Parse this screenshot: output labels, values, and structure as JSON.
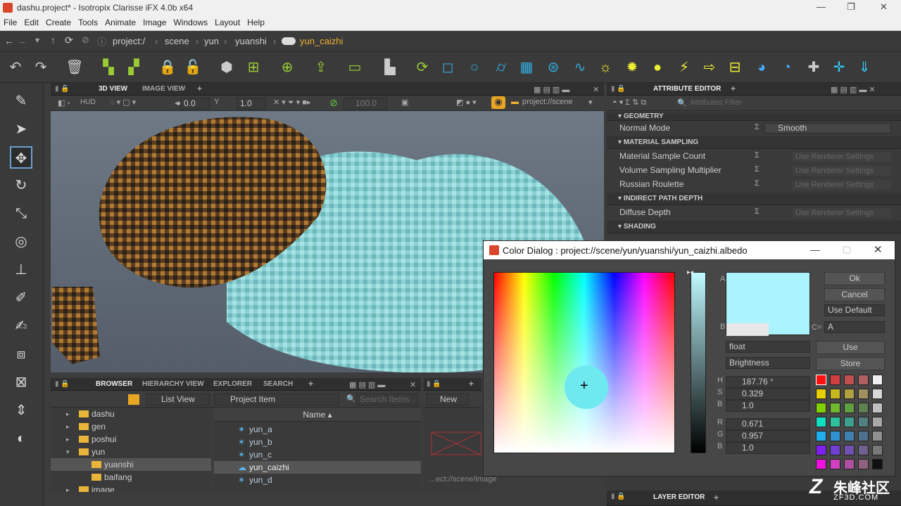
{
  "window": {
    "title": "dashu.project* - Isotropix Clarisse iFX 4.0b x64"
  },
  "menu": [
    "File",
    "Edit",
    "Create",
    "Tools",
    "Animate",
    "Image",
    "Windows",
    "Layout",
    "Help"
  ],
  "breadcrumb": [
    "project:/",
    "scene",
    "yun",
    "yuanshi",
    "yun_caizhi"
  ],
  "viewport": {
    "tabs": [
      "3D VIEW",
      "IMAGE VIEW"
    ],
    "hud": "HUD",
    "field1": "0.0",
    "field2": "1.0",
    "zoom": "100.0 %",
    "path": "project://scene"
  },
  "browser": {
    "tabs": [
      "BROWSER",
      "HIERARCHY VIEW",
      "EXPLORER",
      "SEARCH"
    ],
    "view_mode": "List View",
    "filter": "Project Item",
    "search_placeholder": "Search Items",
    "column_name": "Name",
    "tree": [
      {
        "label": "dashu",
        "indent": 0
      },
      {
        "label": "gen",
        "indent": 0
      },
      {
        "label": "poshui",
        "indent": 0
      },
      {
        "label": "yun",
        "indent": 0
      },
      {
        "label": "yuanshi",
        "indent": 1
      },
      {
        "label": "baifang",
        "indent": 1
      },
      {
        "label": "image",
        "indent": 0
      }
    ],
    "items": [
      "yun_a",
      "yun_b",
      "yun_c",
      "yun_caizhi",
      "yun_d"
    ],
    "new_label": "New",
    "image_path": "...ect://scene/image"
  },
  "attributes": {
    "title": "ATTRIBUTE EDITOR",
    "filter_placeholder": "Attributes Filter",
    "sections": [
      {
        "name": "GEOMETRY",
        "rows": [
          {
            "label": "Normal Mode",
            "value": "Smooth"
          }
        ]
      },
      {
        "name": "MATERIAL SAMPLING",
        "rows": [
          {
            "label": "Material Sample Count",
            "value": "Use Renderer Settings"
          },
          {
            "label": "Volume Sampling Multiplier",
            "value": "Use Renderer Settings"
          },
          {
            "label": "Russian Roulette",
            "value": "Use Renderer Settings"
          }
        ]
      },
      {
        "name": "INDIRECT PATH DEPTH",
        "rows": [
          {
            "label": "Diffuse Depth",
            "value": "Use Renderer Settings"
          }
        ]
      },
      {
        "name": "SHADING",
        "rows": []
      }
    ],
    "layer_editor": "LAYER EDITOR"
  },
  "color_dialog": {
    "title": "Color Dialog : project://scene/yun/yuanshi/yun_caizhi.albedo",
    "ok": "Ok",
    "cancel": "Cancel",
    "use_default": "Use Default",
    "label_a": "A",
    "label_b": "B",
    "label_c": "C=",
    "c_value": "A",
    "type": "float",
    "mode": "Brightness",
    "use": "Use",
    "store": "Store",
    "h": "187.76 °",
    "s": "0.329",
    "b": "1.0",
    "r": "0.671",
    "g": "0.957",
    "bl": "1.0",
    "current_color": "#abf4ff",
    "swatches": [
      [
        "#ff1010",
        "#d04040",
        "#c05050",
        "#b06060",
        "#f0f0f0"
      ],
      [
        "#e8d000",
        "#c8b820",
        "#b0a040",
        "#a09060",
        "#d8d8d8"
      ],
      [
        "#80d000",
        "#70b830",
        "#60a040",
        "#608050",
        "#c0c0c0"
      ],
      [
        "#10e0c0",
        "#30c0a0",
        "#40a090",
        "#508080",
        "#a8a8a8"
      ],
      [
        "#20b0f0",
        "#3090d0",
        "#4080b0",
        "#507090",
        "#909090"
      ],
      [
        "#8020f0",
        "#7040d0",
        "#7050b0",
        "#706090",
        "#787878"
      ],
      [
        "#f010e0",
        "#d040c0",
        "#b050a0",
        "#906080",
        "#101010"
      ]
    ]
  },
  "watermark": {
    "text": "朱峰社区",
    "sub": "ZF3D.COM"
  }
}
